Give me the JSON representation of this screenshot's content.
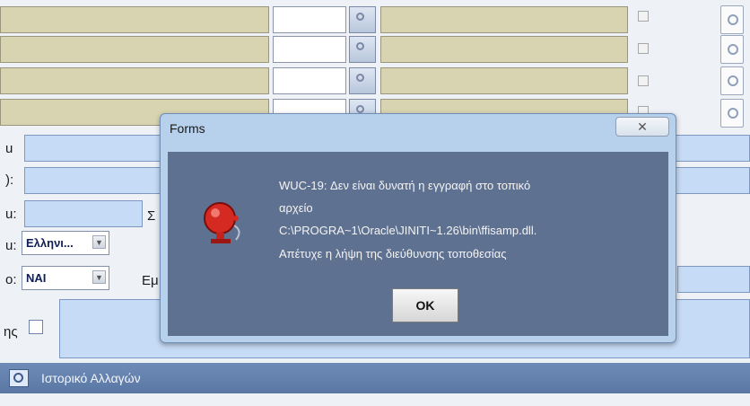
{
  "form": {
    "labels": {
      "row1": "u",
      "row2": "):",
      "row3": "u:",
      "row3_mid": "Σ",
      "row4": "u:",
      "row5": "o:",
      "row5_mid": "Εμ",
      "row6": "ης"
    },
    "combo_language": {
      "value": "Ελληνι..."
    },
    "combo_yesno": {
      "value": "ΝΑΙ"
    }
  },
  "dialog": {
    "title": "Forms",
    "close_label": "✕",
    "message_lines": [
      "WUC-19: Δεν είναι δυνατή η εγγραφή στο τοπικό",
      "αρχείο",
      "C:\\PROGRA~1\\Oracle\\JINITI~1.26\\bin\\ffisamp.dll.",
      "Απέτυχε η λήψη της διεύθυνσης τοποθεσίας"
    ],
    "ok_label": "OK"
  },
  "statusbar": {
    "text": "Ιστορικό Αλλαγών"
  },
  "icons": {
    "alert": "alarm-bell-icon",
    "lov": "search-lov-icon",
    "doc": "document-icon",
    "history": "history-icon"
  },
  "colors": {
    "dialog_body": "#5f7191",
    "field_tan": "#d8d4b2",
    "field_blue": "#c6dbf5",
    "statusbar": "#5a77a3"
  }
}
